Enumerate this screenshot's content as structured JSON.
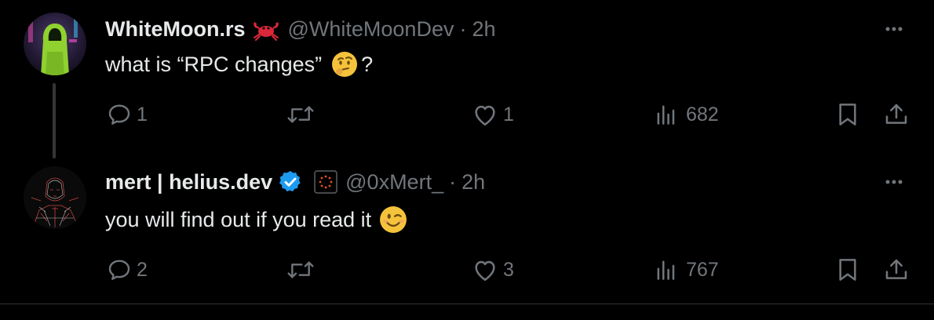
{
  "colors": {
    "background": "#000000",
    "text_primary": "#e7e9ea",
    "text_secondary": "#71767b",
    "verified_badge": "#1d9bf0",
    "divider": "#2f3336"
  },
  "tweets": [
    {
      "display_name": "WhiteMoon.rs",
      "name_emoji": "🦀",
      "handle": "@WhiteMoonDev",
      "separator": "·",
      "time": "2h",
      "text": "what is “RPC changes”",
      "text_emoji": "🤔",
      "text_suffix": "?",
      "replies": "1",
      "reposts": "",
      "likes": "1",
      "views": "682",
      "avatar_icon": "hooded-figure-avatar-icon"
    },
    {
      "display_name": "mert | helius.dev",
      "verified": true,
      "affiliate_icon": "helius-logo-icon",
      "handle": "@0xMert_",
      "separator": "·",
      "time": "2h",
      "text": "you will find out if you read it",
      "text_emoji": "😉",
      "replies": "2",
      "reposts": "",
      "likes": "3",
      "views": "767",
      "avatar_icon": "sketch-portrait-avatar-icon"
    }
  ]
}
